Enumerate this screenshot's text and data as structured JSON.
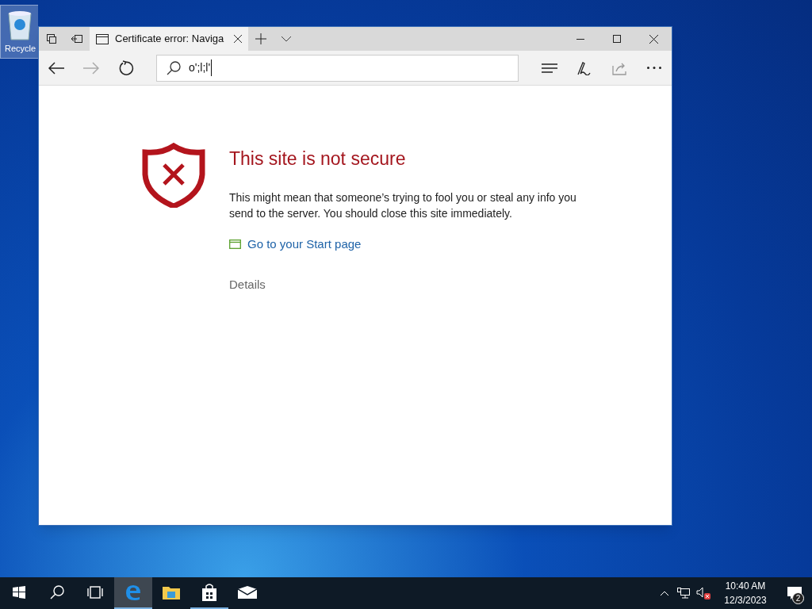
{
  "desktop_icons": [
    {
      "label": "Recycle"
    }
  ],
  "browser": {
    "tabs": [
      {
        "title": "Certificate error: Naviga",
        "selected": true
      }
    ],
    "address_bar": {
      "value": "o';l;l'"
    },
    "page": {
      "title": "This site is not secure",
      "message": "This might mean that someone’s trying to fool you or steal any info you send to the server. You should close this site immediately.",
      "link": "Go to your Start page",
      "details": "Details"
    }
  },
  "taskbar": {
    "apps": [
      {
        "kind": "start",
        "selected": false,
        "running": false
      },
      {
        "kind": "search",
        "selected": false,
        "running": false
      },
      {
        "kind": "taskview",
        "selected": false,
        "running": false
      },
      {
        "kind": "edge",
        "selected": true,
        "running": true
      },
      {
        "kind": "explorer",
        "selected": false,
        "running": false
      },
      {
        "kind": "store",
        "selected": false,
        "running": true
      },
      {
        "kind": "mail",
        "selected": false,
        "running": false
      }
    ],
    "time": "10:40 AM",
    "date": "12/3/2023",
    "notification_count": "2"
  }
}
